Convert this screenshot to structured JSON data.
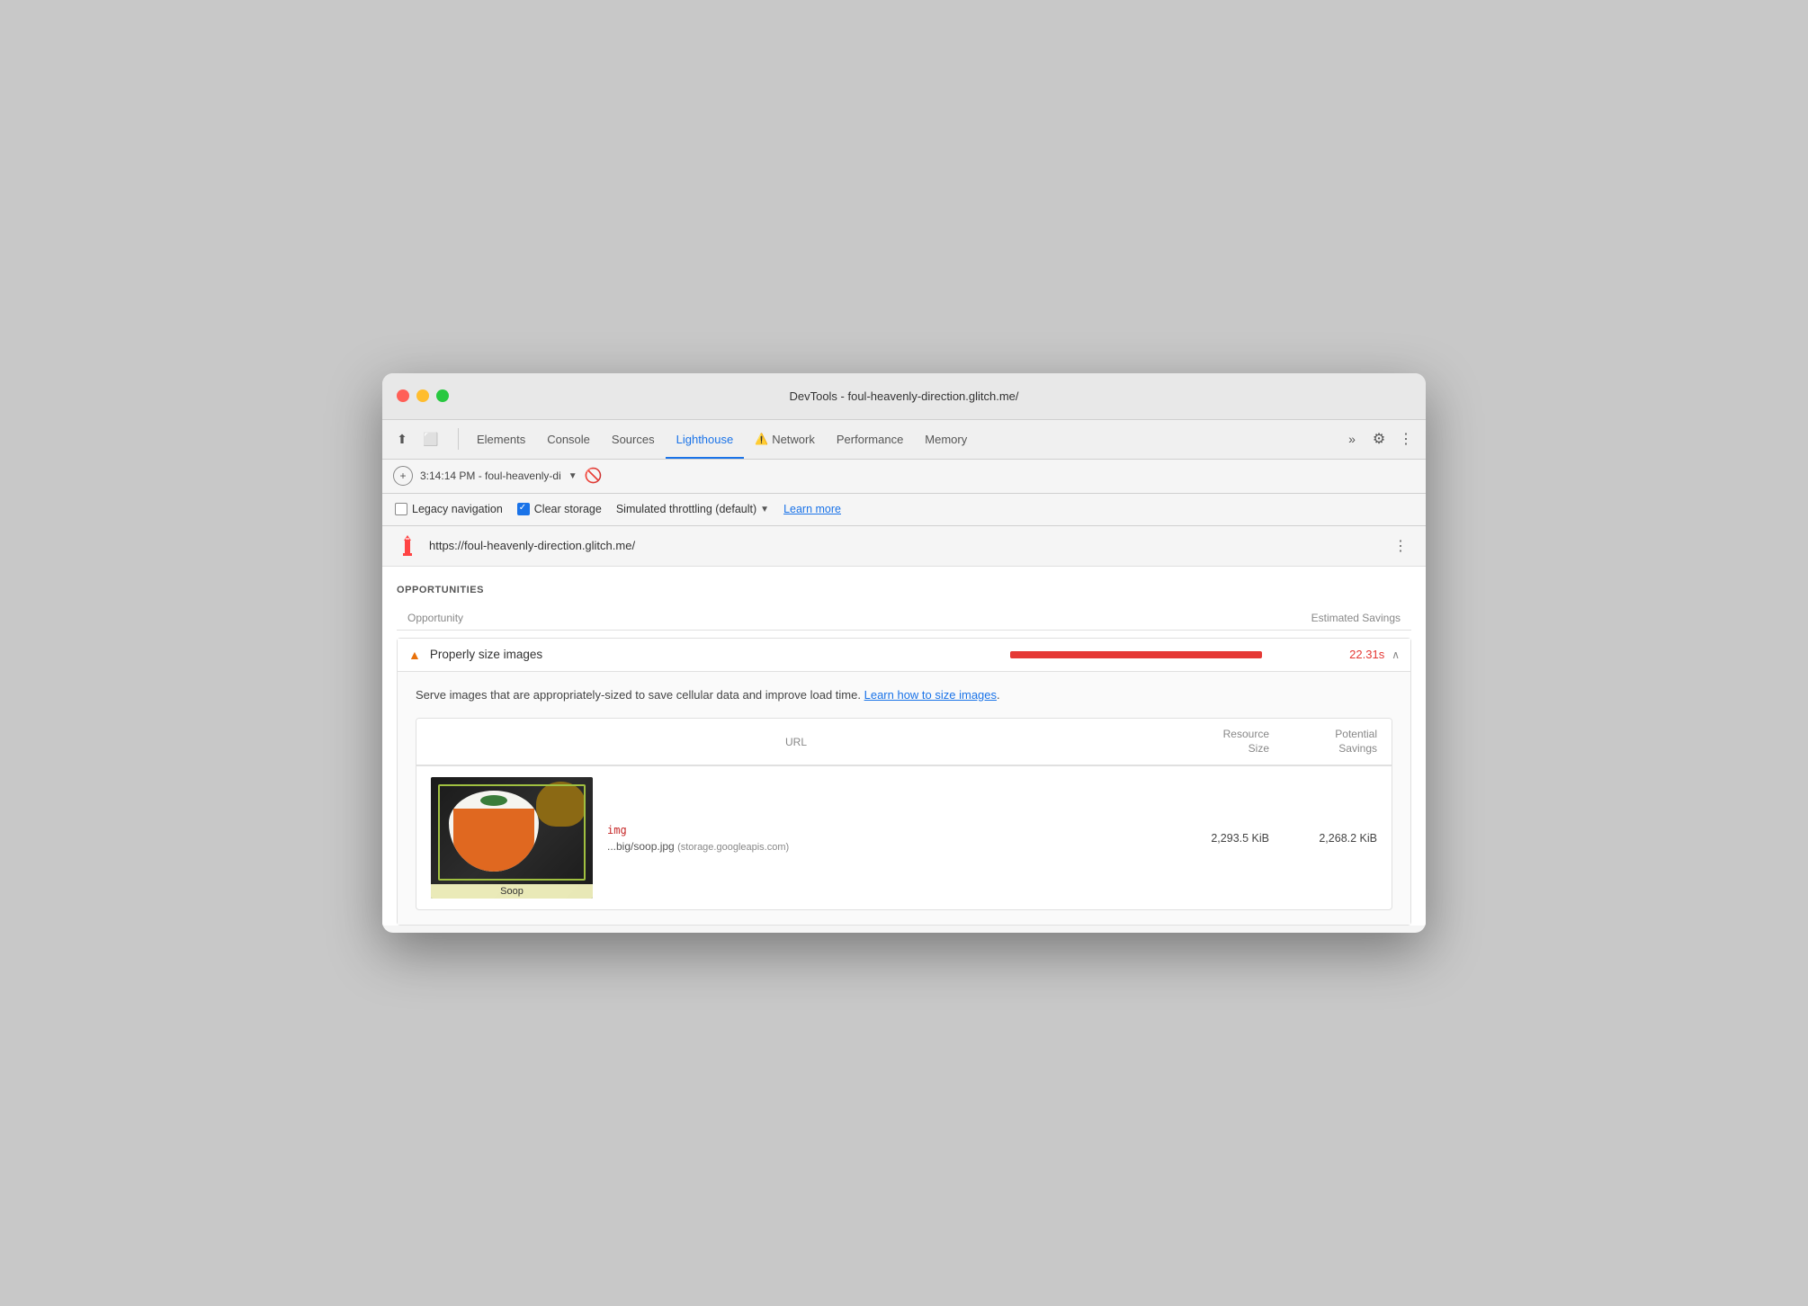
{
  "window": {
    "title": "DevTools - foul-heavenly-direction.glitch.me/"
  },
  "tabs": {
    "items": [
      {
        "id": "elements",
        "label": "Elements",
        "active": false
      },
      {
        "id": "console",
        "label": "Console",
        "active": false
      },
      {
        "id": "sources",
        "label": "Sources",
        "active": false
      },
      {
        "id": "lighthouse",
        "label": "Lighthouse",
        "active": true
      },
      {
        "id": "network",
        "label": "Network",
        "active": false,
        "warning": "⚠"
      },
      {
        "id": "performance",
        "label": "Performance",
        "active": false
      },
      {
        "id": "memory",
        "label": "Memory",
        "active": false
      }
    ]
  },
  "subtoolbar": {
    "add_label": "+",
    "session": "3:14:14 PM - foul-heavenly-di",
    "no_entry": "🚫"
  },
  "options_bar": {
    "legacy_navigation_label": "Legacy navigation",
    "clear_storage_label": "Clear storage",
    "throttling_label": "Simulated throttling (default)",
    "learn_more_label": "Learn more"
  },
  "url_bar": {
    "url": "https://foul-heavenly-direction.glitch.me/"
  },
  "opportunities": {
    "section_title": "OPPORTUNITIES",
    "col_opportunity": "Opportunity",
    "col_estimated_savings": "Estimated Savings",
    "audit": {
      "title": "Properly size images",
      "savings": "22.31s",
      "description": "Serve images that are appropriately-sized to save cellular data and improve load time.",
      "learn_link_text": "Learn how to size images",
      "table": {
        "col_url": "URL",
        "col_resource_size": "Resource\nSize",
        "col_potential_savings": "Potential\nSavings",
        "rows": [
          {
            "tag": "img",
            "url": "...big/soop.jpg",
            "domain": "(storage.googleapis.com)",
            "resource_size": "2,293.5 KiB",
            "potential_savings": "2,268.2 KiB"
          }
        ]
      }
    }
  },
  "icons": {
    "cursor": "⬆",
    "inspector": "⬜",
    "more_tabs": "»",
    "settings": "⚙",
    "menu": "⋮",
    "dropdown": "▼",
    "chevron_up": "∧",
    "url_menu": "⋮"
  }
}
